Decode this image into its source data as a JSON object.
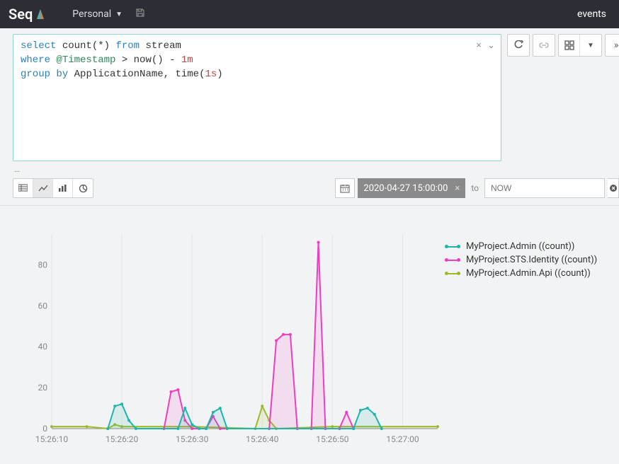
{
  "header": {
    "logo": "Seq",
    "workspace": "Personal",
    "events_link": "events"
  },
  "query": {
    "line1_kw1": "select",
    "line1_fn": " count",
    "line1_rest": "(*) ",
    "line1_kw2": "from",
    "line1_stream": " stream",
    "line2_kw": "where",
    "line2_at": " @Timestamp ",
    "line2_op": "> ",
    "line2_fn": "now",
    "line2_paren": "() - ",
    "line2_num": "1m",
    "line3_kw1": "group",
    "line3_kw2": " by",
    "line3_rest": " ApplicationName, time(",
    "line3_num": "1s",
    "line3_close": ")",
    "clear_symbol": "×",
    "expand_symbol": "⌄"
  },
  "ellipsis": "…",
  "date": {
    "from": "2020-04-27 15:00:00",
    "from_clear": "×",
    "to_label": "to",
    "now_placeholder": "NOW"
  },
  "legend": {
    "s1": "MyProject.Admin ((count))",
    "s2": "MyProject.STS.Identity ((count))",
    "s3": "MyProject.Admin.Api ((count))"
  },
  "chart_data": {
    "type": "line",
    "x_labels": [
      "15:26:10",
      "15:26:20",
      "15:26:30",
      "15:26:40",
      "15:26:50",
      "15:27:00"
    ],
    "y_ticks": [
      0,
      20,
      40,
      60,
      80
    ],
    "ylim": [
      0,
      95
    ],
    "x_domain": [
      0,
      55
    ],
    "series": [
      {
        "name": "MyProject.Admin",
        "color": "#1fb5ad",
        "points": [
          {
            "x": 8,
            "y": 0
          },
          {
            "x": 9,
            "y": 11
          },
          {
            "x": 10,
            "y": 12
          },
          {
            "x": 11,
            "y": 4
          },
          {
            "x": 12,
            "y": 0
          },
          {
            "x": 18,
            "y": 0
          },
          {
            "x": 19,
            "y": 10
          },
          {
            "x": 20,
            "y": 2
          },
          {
            "x": 21,
            "y": 0
          },
          {
            "x": 22,
            "y": 0
          },
          {
            "x": 23,
            "y": 8
          },
          {
            "x": 24,
            "y": 10
          },
          {
            "x": 25,
            "y": 0
          },
          {
            "x": 43,
            "y": 0
          },
          {
            "x": 44,
            "y": 9
          },
          {
            "x": 45,
            "y": 10
          },
          {
            "x": 46,
            "y": 7
          },
          {
            "x": 47,
            "y": 0
          }
        ]
      },
      {
        "name": "MyProject.STS.Identity",
        "color": "#ec3fc0",
        "points": [
          {
            "x": 16,
            "y": 0
          },
          {
            "x": 17,
            "y": 18
          },
          {
            "x": 18,
            "y": 19
          },
          {
            "x": 19,
            "y": 4
          },
          {
            "x": 20,
            "y": 0
          },
          {
            "x": 22,
            "y": 0
          },
          {
            "x": 23,
            "y": 6
          },
          {
            "x": 24,
            "y": 0
          },
          {
            "x": 31,
            "y": 0
          },
          {
            "x": 32,
            "y": 43
          },
          {
            "x": 33,
            "y": 46
          },
          {
            "x": 34,
            "y": 46
          },
          {
            "x": 35,
            "y": 0
          },
          {
            "x": 37,
            "y": 0
          },
          {
            "x": 38,
            "y": 91
          },
          {
            "x": 39,
            "y": 0
          },
          {
            "x": 41,
            "y": 0
          },
          {
            "x": 42,
            "y": 8
          },
          {
            "x": 43,
            "y": 0
          }
        ]
      },
      {
        "name": "MyProject.Admin.Api",
        "color": "#9bbb2b",
        "points": [
          {
            "x": 0,
            "y": 1
          },
          {
            "x": 5,
            "y": 1
          },
          {
            "x": 8,
            "y": 0
          },
          {
            "x": 9,
            "y": 2
          },
          {
            "x": 10,
            "y": 1
          },
          {
            "x": 20,
            "y": 1
          },
          {
            "x": 29,
            "y": 0
          },
          {
            "x": 30,
            "y": 11
          },
          {
            "x": 31,
            "y": 4
          },
          {
            "x": 32,
            "y": 0
          },
          {
            "x": 40,
            "y": 1
          },
          {
            "x": 55,
            "y": 1
          }
        ]
      }
    ]
  }
}
